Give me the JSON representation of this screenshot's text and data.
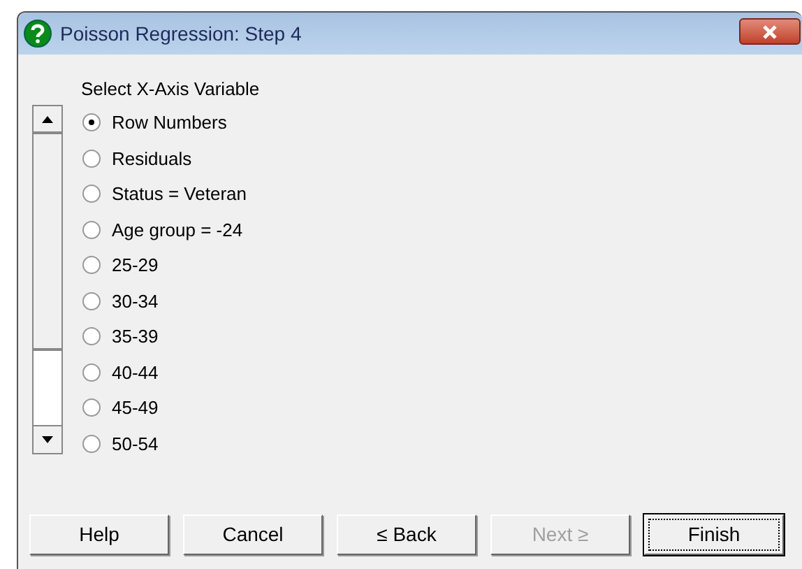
{
  "window": {
    "title": "Poisson Regression: Step 4"
  },
  "prompt": "Select X-Axis Variable",
  "options": [
    {
      "label": "Row Numbers",
      "selected": true
    },
    {
      "label": "Residuals",
      "selected": false
    },
    {
      "label": "Status = Veteran",
      "selected": false
    },
    {
      "label": "Age group = -24",
      "selected": false
    },
    {
      "label": "25-29",
      "selected": false
    },
    {
      "label": "30-34",
      "selected": false
    },
    {
      "label": "35-39",
      "selected": false
    },
    {
      "label": "40-44",
      "selected": false
    },
    {
      "label": "45-49",
      "selected": false
    },
    {
      "label": "50-54",
      "selected": false
    }
  ],
  "buttons": [
    {
      "label": "Help",
      "disabled": false,
      "focused": false
    },
    {
      "label": "Cancel",
      "disabled": false,
      "focused": false
    },
    {
      "label": "≤ Back",
      "disabled": false,
      "focused": false
    },
    {
      "label": "Next ≥",
      "disabled": true,
      "focused": false
    },
    {
      "label": "Finish",
      "disabled": false,
      "focused": true
    }
  ]
}
